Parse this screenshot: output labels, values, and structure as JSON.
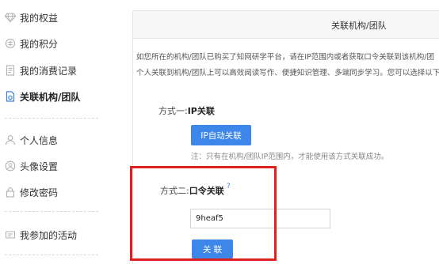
{
  "sidebar": {
    "items": [
      {
        "label": "我的权益",
        "icon": "diamond-icon"
      },
      {
        "label": "我的积分",
        "icon": "points-icon"
      },
      {
        "label": "我的消费记录",
        "icon": "receipt-icon"
      },
      {
        "label": "关联机构/团队",
        "icon": "link-document-icon",
        "active": true
      },
      {
        "label": "个人信息",
        "icon": "user-icon"
      },
      {
        "label": "头像设置",
        "icon": "avatar-icon"
      },
      {
        "label": "修改密码",
        "icon": "lock-icon"
      },
      {
        "label": "我参加的活动",
        "icon": "activity-icon"
      }
    ]
  },
  "panel": {
    "title": "关联机构/团队",
    "intro_line1": "如您所在的机构/团队已购买了知网研学平台，请在IP范围内或者获取口令关联到该机构/团",
    "intro_line2": "个人关联到机构/团队上可以高效阅读写作、便捷知识管理、多端同步学习。您可以选择以下"
  },
  "method1": {
    "prefix": "方式一:",
    "name": "IP关联",
    "button_label": "IP自动关联",
    "note": "注：只有在机构/团队IP范围内，才能使用该方式关联成功。"
  },
  "method2": {
    "prefix": "方式二:",
    "name": "口令关联",
    "help_icon": "?",
    "input_value": "9heaf5",
    "button_label": "关 联"
  },
  "colors": {
    "accent": "#3d86ea",
    "highlight": "#e0201f"
  }
}
